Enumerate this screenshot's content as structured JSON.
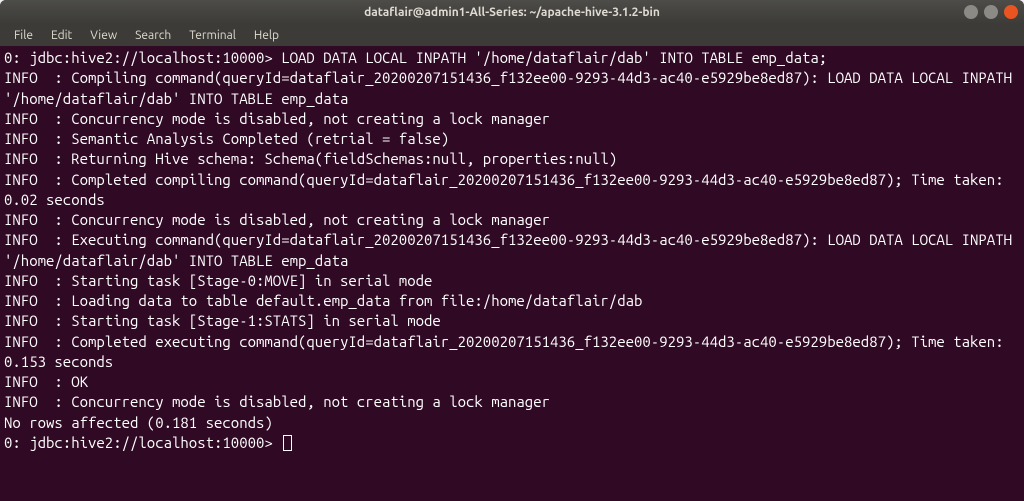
{
  "window": {
    "title": "dataflair@admin1-All-Series: ~/apache-hive-3.1.2-bin"
  },
  "menubar": {
    "items": [
      "File",
      "Edit",
      "View",
      "Search",
      "Terminal",
      "Help"
    ]
  },
  "terminal": {
    "prompt": "0: jdbc:hive2://localhost:10000> ",
    "command": "LOAD DATA LOCAL INPATH '/home/dataflair/dab' INTO TABLE emp_data;",
    "lines": [
      "INFO  : Compiling command(queryId=dataflair_20200207151436_f132ee00-9293-44d3-ac40-e5929be8ed87): LOAD DATA LOCAL INPATH '/home/dataflair/dab' INTO TABLE emp_data",
      "INFO  : Concurrency mode is disabled, not creating a lock manager",
      "INFO  : Semantic Analysis Completed (retrial = false)",
      "INFO  : Returning Hive schema: Schema(fieldSchemas:null, properties:null)",
      "INFO  : Completed compiling command(queryId=dataflair_20200207151436_f132ee00-9293-44d3-ac40-e5929be8ed87); Time taken: 0.02 seconds",
      "INFO  : Concurrency mode is disabled, not creating a lock manager",
      "INFO  : Executing command(queryId=dataflair_20200207151436_f132ee00-9293-44d3-ac40-e5929be8ed87): LOAD DATA LOCAL INPATH '/home/dataflair/dab' INTO TABLE emp_data",
      "INFO  : Starting task [Stage-0:MOVE] in serial mode",
      "INFO  : Loading data to table default.emp_data from file:/home/dataflair/dab",
      "INFO  : Starting task [Stage-1:STATS] in serial mode",
      "INFO  : Completed executing command(queryId=dataflair_20200207151436_f132ee00-9293-44d3-ac40-e5929be8ed87); Time taken: 0.153 seconds",
      "INFO  : OK",
      "INFO  : Concurrency mode is disabled, not creating a lock manager",
      "No rows affected (0.181 seconds)"
    ],
    "prompt2": "0: jdbc:hive2://localhost:10000> "
  }
}
